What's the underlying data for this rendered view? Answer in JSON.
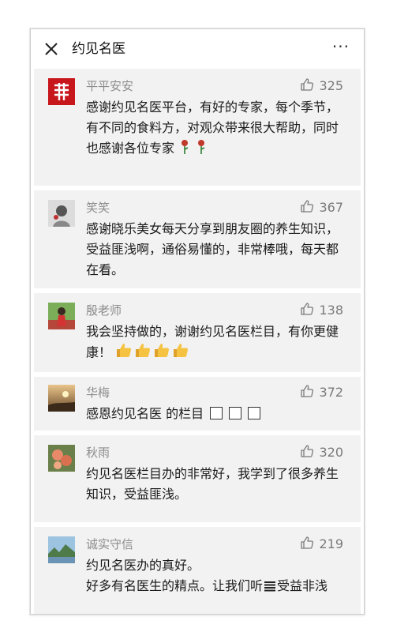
{
  "header": {
    "title": "约见名医",
    "more_label": "···"
  },
  "comments": [
    {
      "name": "平平安安",
      "likes": "325",
      "text_main": "感谢约见名医平台，有好的专家，每个季节，有不同的食料方，对观众带来很大帮助，同时也感谢各位专家",
      "trailing_icon": "rose-icon"
    },
    {
      "name": "笑笑",
      "likes": "367",
      "text_main": "感谢晓乐美女每天分享到朋友圈的养生知识，受益匪浅啊，通俗易懂的，非常棒哦，每天都在看。"
    },
    {
      "name": "殷老师",
      "likes": "138",
      "text_main": "我会坚持做的，谢谢约见名医栏目，有你更健康！",
      "trailing_icon": "thumbs-up-emoji"
    },
    {
      "name": "华梅",
      "likes": "372",
      "text_main": "感恩约见名医 的栏目",
      "trailing_icon": "missing-glyph-box"
    },
    {
      "name": "秋雨",
      "likes": "320",
      "text_main": "约见名医栏目办的非常好，我学到了很多养生知识，受益匪浅。"
    },
    {
      "name": "诚实守信",
      "likes": "219",
      "text_line1": "约见名医办的真好。",
      "text_line2a": "好多有名医生的精点。让我们听",
      "text_line2b": "受益非浅"
    }
  ],
  "colors": {
    "card_bg": "#f2f2f2",
    "name_gray": "#8c8c8c",
    "text": "#1a1a1a",
    "like_gray": "#7a7a7a"
  }
}
